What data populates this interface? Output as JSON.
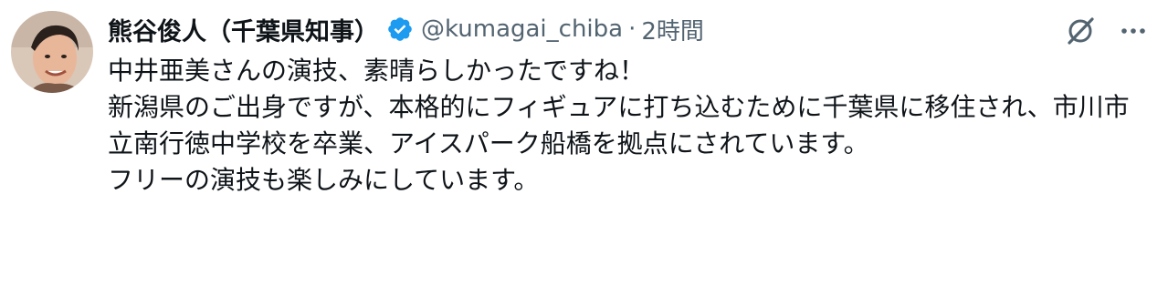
{
  "tweet": {
    "display_name": "熊谷俊人（千葉県知事）",
    "handle": "@kumagai_chiba",
    "separator": "·",
    "time": "2時間",
    "verified_color": "#1d9bf0",
    "paragraphs": [
      "中井亜美さんの演技、素晴らしかったですね！",
      "新潟県のご出身ですが、本格的にフィギュアに打ち込むために千葉県に移住され、市川市立南行徳中学校を卒業、アイスパーク船橋を拠点にされています。",
      "フリーの演技も楽しみにしています。"
    ]
  },
  "icons": {
    "avatar": "user-avatar",
    "verified": "verified-badge-icon",
    "grok": "grok-icon",
    "more": "more-options-icon"
  }
}
